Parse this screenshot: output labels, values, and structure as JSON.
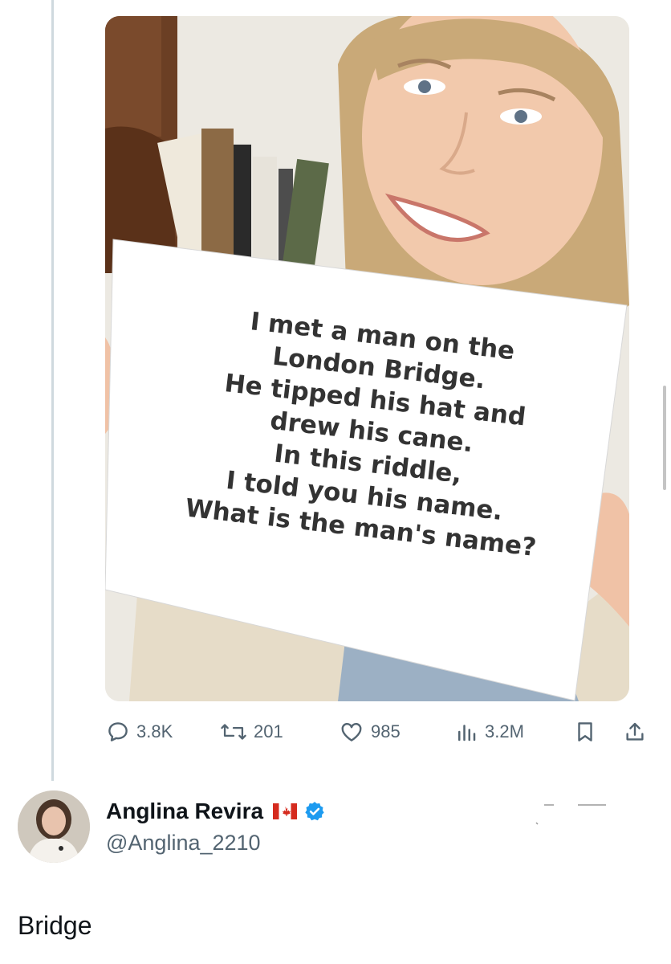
{
  "post": {
    "image_sign_lines": [
      "I met a man on the",
      "London Bridge.",
      "He tipped his hat and",
      "drew his cane.",
      "In this riddle,",
      "I told you his name.",
      "What is the man's name?"
    ],
    "actions": {
      "replies": "3.8K",
      "reposts": "201",
      "likes": "985",
      "views": "3.2M"
    },
    "icons": {
      "reply": "speech-bubble-icon",
      "repost": "repost-arrows-icon",
      "like": "heart-icon",
      "views": "bar-chart-icon",
      "bookmark": "bookmark-icon",
      "share": "share-upload-icon"
    }
  },
  "reply": {
    "display_name": "Anglina Revira",
    "handle": "@Anglina_2210",
    "text": "Bridge",
    "badges": [
      "canada-flag-icon",
      "verified-badge-icon"
    ]
  },
  "colors": {
    "text_primary": "#0f1419",
    "text_secondary": "#536471",
    "verified": "#1d9bf0",
    "thread_line": "#cfd9de",
    "flag_red": "#d52b1e"
  }
}
